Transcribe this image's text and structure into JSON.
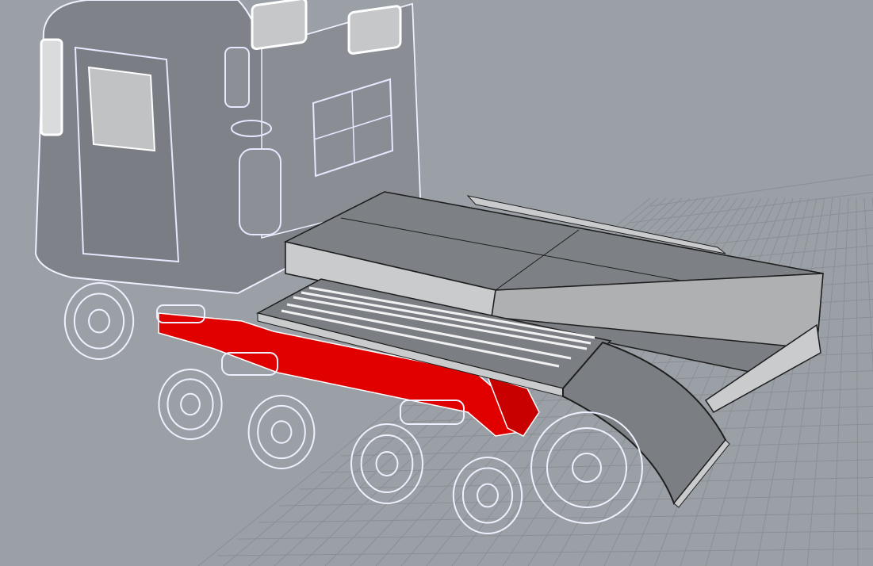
{
  "viewport": {
    "colors": {
      "background": "#9ba0a6",
      "grid_line": "#8a8f95",
      "wire": "#e6e8ff",
      "wire_edge": "#ffffff",
      "cab_fill": "#7f8389",
      "cab_shade": "#6f7379",
      "bed_top": "#7b7e82",
      "bed_side": "#c9cbcd",
      "selection_red": "#e00000",
      "dark_line": "#2a2a2a"
    },
    "objects": [
      {
        "name": "cab",
        "selected": false
      },
      {
        "name": "flatbed-deck",
        "selected": false
      },
      {
        "name": "frame-rail",
        "selected": true
      },
      {
        "name": "track-bogies",
        "selected": false
      },
      {
        "name": "rear-fender",
        "selected": false
      }
    ]
  }
}
